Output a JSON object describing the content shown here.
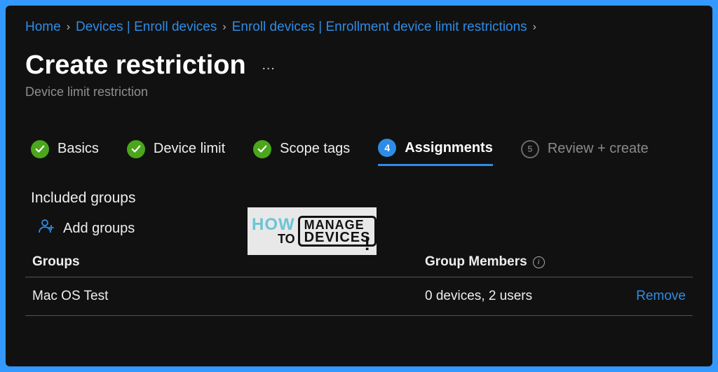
{
  "breadcrumb": {
    "items": [
      {
        "label": "Home"
      },
      {
        "label": "Devices | Enroll devices"
      },
      {
        "label": "Enroll devices | Enrollment device limit restrictions"
      }
    ]
  },
  "header": {
    "title": "Create restriction",
    "subtitle": "Device limit restriction",
    "more_label": "…"
  },
  "steps": [
    {
      "label": "Basics",
      "state": "done"
    },
    {
      "label": "Device limit",
      "state": "done"
    },
    {
      "label": "Scope tags",
      "state": "done"
    },
    {
      "label": "Assignments",
      "state": "active",
      "number": "4"
    },
    {
      "label": "Review + create",
      "state": "future",
      "number": "5"
    }
  ],
  "section": {
    "included_groups_title": "Included groups",
    "add_groups_label": "Add groups"
  },
  "table": {
    "columns": {
      "groups": "Groups",
      "members": "Group Members"
    },
    "rows": [
      {
        "group": "Mac OS Test",
        "members": "0 devices, 2 users",
        "remove": "Remove"
      }
    ]
  },
  "watermark": {
    "how": "HOW",
    "to": "TO",
    "manage": "MANAGE",
    "devices": "DEVICES"
  }
}
